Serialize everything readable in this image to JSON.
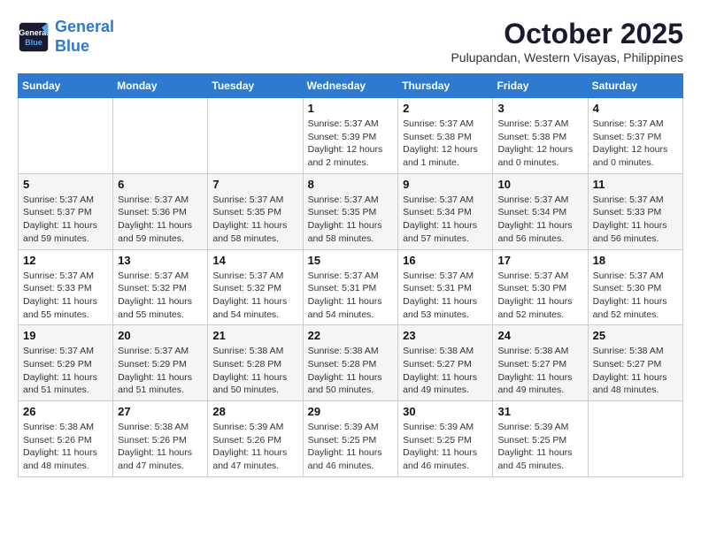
{
  "logo": {
    "line1": "General",
    "line2": "Blue"
  },
  "title": "October 2025",
  "subtitle": "Pulupandan, Western Visayas, Philippines",
  "days_of_week": [
    "Sunday",
    "Monday",
    "Tuesday",
    "Wednesday",
    "Thursday",
    "Friday",
    "Saturday"
  ],
  "weeks": [
    [
      {
        "day": "",
        "info": ""
      },
      {
        "day": "",
        "info": ""
      },
      {
        "day": "",
        "info": ""
      },
      {
        "day": "1",
        "info": "Sunrise: 5:37 AM\nSunset: 5:39 PM\nDaylight: 12 hours\nand 2 minutes."
      },
      {
        "day": "2",
        "info": "Sunrise: 5:37 AM\nSunset: 5:38 PM\nDaylight: 12 hours\nand 1 minute."
      },
      {
        "day": "3",
        "info": "Sunrise: 5:37 AM\nSunset: 5:38 PM\nDaylight: 12 hours\nand 0 minutes."
      },
      {
        "day": "4",
        "info": "Sunrise: 5:37 AM\nSunset: 5:37 PM\nDaylight: 12 hours\nand 0 minutes."
      }
    ],
    [
      {
        "day": "5",
        "info": "Sunrise: 5:37 AM\nSunset: 5:37 PM\nDaylight: 11 hours\nand 59 minutes."
      },
      {
        "day": "6",
        "info": "Sunrise: 5:37 AM\nSunset: 5:36 PM\nDaylight: 11 hours\nand 59 minutes."
      },
      {
        "day": "7",
        "info": "Sunrise: 5:37 AM\nSunset: 5:35 PM\nDaylight: 11 hours\nand 58 minutes."
      },
      {
        "day": "8",
        "info": "Sunrise: 5:37 AM\nSunset: 5:35 PM\nDaylight: 11 hours\nand 58 minutes."
      },
      {
        "day": "9",
        "info": "Sunrise: 5:37 AM\nSunset: 5:34 PM\nDaylight: 11 hours\nand 57 minutes."
      },
      {
        "day": "10",
        "info": "Sunrise: 5:37 AM\nSunset: 5:34 PM\nDaylight: 11 hours\nand 56 minutes."
      },
      {
        "day": "11",
        "info": "Sunrise: 5:37 AM\nSunset: 5:33 PM\nDaylight: 11 hours\nand 56 minutes."
      }
    ],
    [
      {
        "day": "12",
        "info": "Sunrise: 5:37 AM\nSunset: 5:33 PM\nDaylight: 11 hours\nand 55 minutes."
      },
      {
        "day": "13",
        "info": "Sunrise: 5:37 AM\nSunset: 5:32 PM\nDaylight: 11 hours\nand 55 minutes."
      },
      {
        "day": "14",
        "info": "Sunrise: 5:37 AM\nSunset: 5:32 PM\nDaylight: 11 hours\nand 54 minutes."
      },
      {
        "day": "15",
        "info": "Sunrise: 5:37 AM\nSunset: 5:31 PM\nDaylight: 11 hours\nand 54 minutes."
      },
      {
        "day": "16",
        "info": "Sunrise: 5:37 AM\nSunset: 5:31 PM\nDaylight: 11 hours\nand 53 minutes."
      },
      {
        "day": "17",
        "info": "Sunrise: 5:37 AM\nSunset: 5:30 PM\nDaylight: 11 hours\nand 52 minutes."
      },
      {
        "day": "18",
        "info": "Sunrise: 5:37 AM\nSunset: 5:30 PM\nDaylight: 11 hours\nand 52 minutes."
      }
    ],
    [
      {
        "day": "19",
        "info": "Sunrise: 5:37 AM\nSunset: 5:29 PM\nDaylight: 11 hours\nand 51 minutes."
      },
      {
        "day": "20",
        "info": "Sunrise: 5:37 AM\nSunset: 5:29 PM\nDaylight: 11 hours\nand 51 minutes."
      },
      {
        "day": "21",
        "info": "Sunrise: 5:38 AM\nSunset: 5:28 PM\nDaylight: 11 hours\nand 50 minutes."
      },
      {
        "day": "22",
        "info": "Sunrise: 5:38 AM\nSunset: 5:28 PM\nDaylight: 11 hours\nand 50 minutes."
      },
      {
        "day": "23",
        "info": "Sunrise: 5:38 AM\nSunset: 5:27 PM\nDaylight: 11 hours\nand 49 minutes."
      },
      {
        "day": "24",
        "info": "Sunrise: 5:38 AM\nSunset: 5:27 PM\nDaylight: 11 hours\nand 49 minutes."
      },
      {
        "day": "25",
        "info": "Sunrise: 5:38 AM\nSunset: 5:27 PM\nDaylight: 11 hours\nand 48 minutes."
      }
    ],
    [
      {
        "day": "26",
        "info": "Sunrise: 5:38 AM\nSunset: 5:26 PM\nDaylight: 11 hours\nand 48 minutes."
      },
      {
        "day": "27",
        "info": "Sunrise: 5:38 AM\nSunset: 5:26 PM\nDaylight: 11 hours\nand 47 minutes."
      },
      {
        "day": "28",
        "info": "Sunrise: 5:39 AM\nSunset: 5:26 PM\nDaylight: 11 hours\nand 47 minutes."
      },
      {
        "day": "29",
        "info": "Sunrise: 5:39 AM\nSunset: 5:25 PM\nDaylight: 11 hours\nand 46 minutes."
      },
      {
        "day": "30",
        "info": "Sunrise: 5:39 AM\nSunset: 5:25 PM\nDaylight: 11 hours\nand 46 minutes."
      },
      {
        "day": "31",
        "info": "Sunrise: 5:39 AM\nSunset: 5:25 PM\nDaylight: 11 hours\nand 45 minutes."
      },
      {
        "day": "",
        "info": ""
      }
    ]
  ]
}
